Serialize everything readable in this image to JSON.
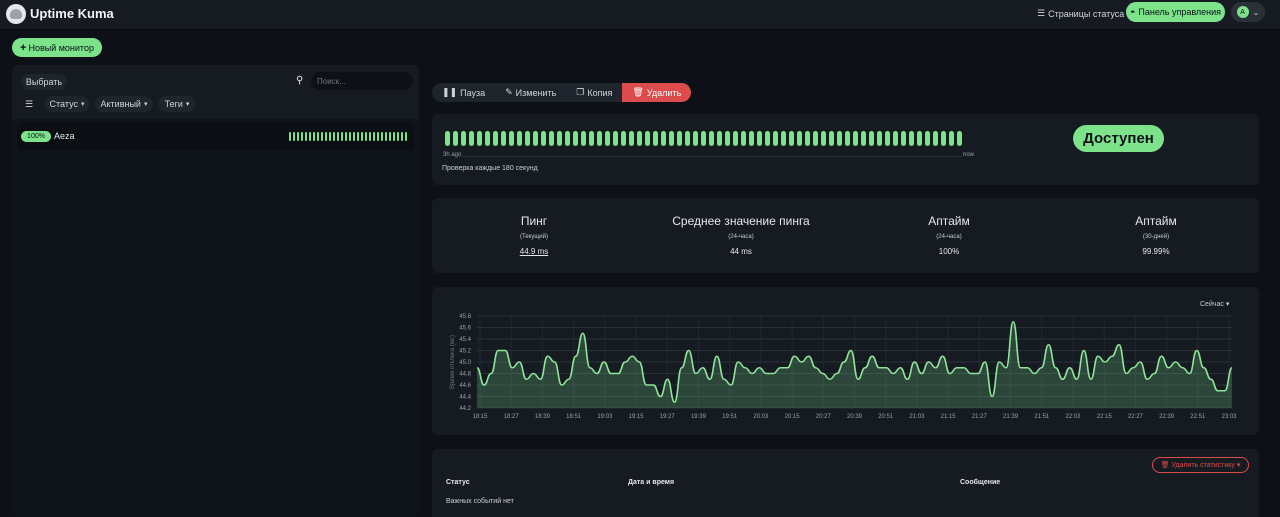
{
  "header": {
    "brand": "Uptime Kuma",
    "status_pages": "Страницы статуса",
    "dashboard": "Панель управления",
    "avatar_letter": "A"
  },
  "sidebar": {
    "new_monitor": "Новый монитор",
    "select": "Выбрать",
    "search_placeholder": "Поиск...",
    "filters": [
      "Статус",
      "Активный",
      "Теги"
    ],
    "monitors": [
      {
        "uptime": "100%",
        "name": "Aeza"
      }
    ]
  },
  "actions": {
    "pause": "Пауза",
    "edit": "Изменить",
    "clone": "Копия",
    "delete": "Удалить"
  },
  "heartbeat": {
    "ago": "3h ago",
    "now": "now",
    "interval": "Проверка каждые 180 секунд",
    "status": "Доступен"
  },
  "stats": [
    {
      "title": "Пинг",
      "sub": "(Текущий)",
      "value": "44.9 ms"
    },
    {
      "title": "Среднее значение пинга",
      "sub": "(24-часа)",
      "value": "44 ms"
    },
    {
      "title": "Аптайм",
      "sub": "(24-часа)",
      "value": "100%"
    },
    {
      "title": "Аптайм",
      "sub": "(30-дней)",
      "value": "99.99%"
    }
  ],
  "chart_data": {
    "type": "area",
    "period": "Сейчас",
    "ylabel": "Время отклика (мс)",
    "ylim": [
      44.2,
      45.8
    ],
    "yticks": [
      "45.8",
      "45.6",
      "45.4",
      "45.2",
      "45.0",
      "44.8",
      "44.6",
      "44.4",
      "44.2"
    ],
    "xticks": [
      "18:15",
      "18:27",
      "18:39",
      "18:51",
      "19:03",
      "19:15",
      "19:27",
      "19:39",
      "19:51",
      "20:03",
      "20:15",
      "20:27",
      "20:39",
      "20:51",
      "21:03",
      "21:15",
      "21:27",
      "21:39",
      "21:51",
      "22:03",
      "22:15",
      "22:27",
      "22:39",
      "22:51",
      "23:03"
    ],
    "series": [
      {
        "values": [
          44.9,
          44.6,
          44.8,
          45.2,
          45.2,
          44.9,
          45.0,
          44.7,
          44.8,
          44.7,
          45.1,
          45.0,
          44.6,
          44.7,
          45.1,
          45.5,
          44.9,
          44.8,
          45.0,
          44.8,
          44.8,
          45.0,
          45.1,
          45.0,
          44.6,
          44.6,
          44.4,
          44.7,
          44.3,
          44.9,
          45.2,
          44.8,
          44.9,
          44.7,
          45.1,
          44.7,
          44.6,
          45.0,
          44.9,
          44.8,
          44.9,
          44.8,
          44.8,
          44.9,
          44.9,
          45.1,
          45.0,
          45.1,
          44.9,
          44.8,
          44.7,
          44.8,
          45.0,
          45.2,
          44.7,
          44.9,
          45.1,
          44.9,
          44.9,
          44.8,
          44.9,
          44.7,
          45.0,
          44.8,
          45.0,
          44.9,
          45.1,
          44.8,
          44.9,
          44.9,
          44.8,
          44.8,
          45.0,
          44.4,
          45.0,
          44.9,
          45.7,
          44.9,
          44.9,
          44.8,
          44.9,
          45.3,
          44.9,
          44.7,
          44.9,
          44.7,
          45.2,
          44.7,
          45.1,
          45.0,
          45.1,
          45.3,
          44.8,
          44.9,
          45.0,
          44.7,
          44.8,
          45.1,
          44.9,
          45.0,
          44.9,
          44.8,
          45.2,
          44.9,
          44.7,
          44.5,
          44.5,
          44.9
        ]
      }
    ]
  },
  "events": {
    "clear_stats": "Удалить статистику",
    "columns": [
      "Статус",
      "Дата и время",
      "Сообщение"
    ],
    "empty": "Важных событий нет"
  }
}
